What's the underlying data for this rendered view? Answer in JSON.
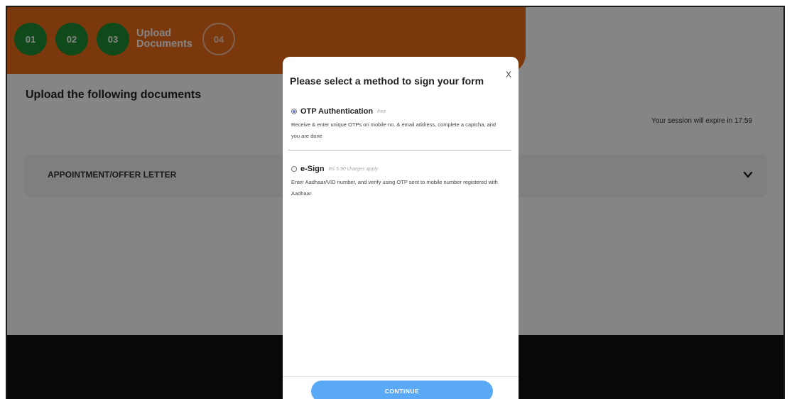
{
  "header": {
    "steps": [
      "01",
      "02",
      "03"
    ],
    "current_step_label_line1": "Upload",
    "current_step_label_line2": "Documents",
    "pending_step": "04",
    "accent_color": "#ee6b1a",
    "done_color": "#1f8f32"
  },
  "page": {
    "title": "Upload the following documents",
    "session_text": "Your session will expire in 17:59"
  },
  "accordion": {
    "title": "APPOINTMENT/OFFER LETTER",
    "icon": "chevron-down-icon"
  },
  "modal": {
    "title": "Please select a method to sign your form",
    "close_label": "X",
    "options": [
      {
        "name": "OTP Authentication",
        "note": "free",
        "description": "Receive & enter unique OTPs on mobile no. & email address, complete a captcha, and you are done",
        "selected": true
      },
      {
        "name": "e-Sign",
        "note": "Rs 5.90 charges apply",
        "description": "Enter Aadhaar/VID number, and verify using OTP sent to mobile number registered with Aadhaar.",
        "selected": false
      }
    ],
    "continue_label": "CONTINUE",
    "continue_color": "#5aa9f5"
  }
}
